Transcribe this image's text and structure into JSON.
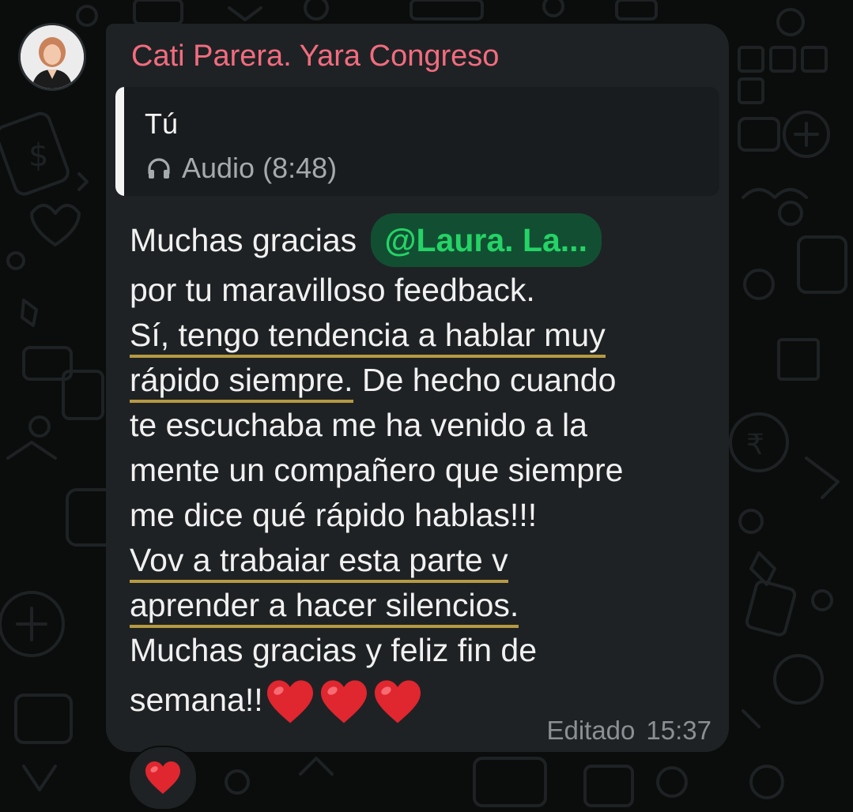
{
  "colors": {
    "background": "#0b0d0c",
    "bubble": "#1f2224",
    "sender": "#f26c7f",
    "mention_bg": "#124f32",
    "mention_text": "#25d366",
    "highlight_underline": "#b59a43",
    "heart": "#e0262f"
  },
  "message": {
    "sender": "Cati Parera. Yara Congreso",
    "reply": {
      "author": "Tú",
      "icon": "headphones-icon",
      "label": "Audio (8:48)"
    },
    "line1_text": "Muchas gracias",
    "mention": "@Laura. La...",
    "line2": "por tu maravilloso feedback.",
    "line3": "Sí, tengo tendencia a hablar muy",
    "line4_highlight": "rápido siempre.",
    "line4_rest": " De hecho cuando",
    "line5": "te escuchaba me ha venido a la",
    "line6": "mente un compañero que siempre",
    "line7": "me dice qué rápido hablas!!!",
    "line8": "Vov a trabaiar esta parte v",
    "line9": "aprender a hacer silencios.",
    "line10": "Muchas gracias y feliz fin de",
    "line11_text": "semana!!",
    "line11_emoji_count": 3,
    "edited_label": "Editado",
    "time": "15:37"
  },
  "reaction": {
    "emoji": "heart-icon",
    "count_shown": ""
  }
}
